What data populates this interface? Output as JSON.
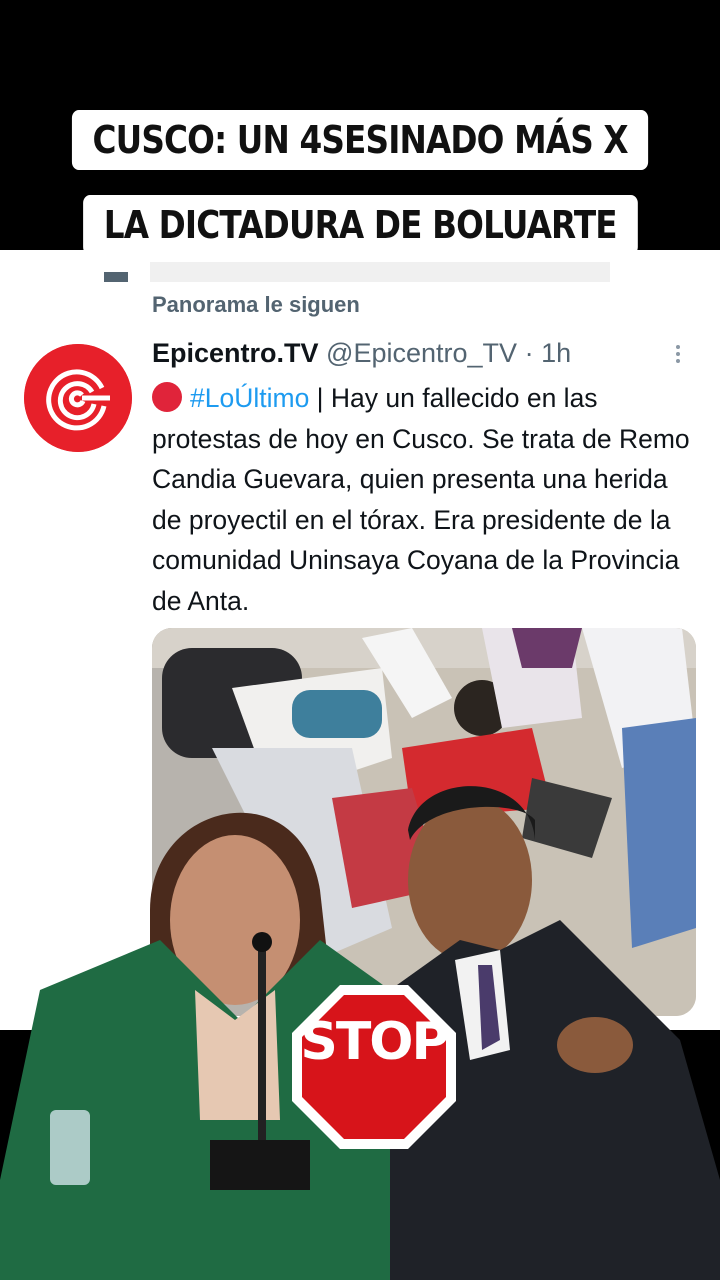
{
  "caption": {
    "line1": "CUSCO: UN 4SESINADO MÁS X",
    "line2": "LA DICTADURA DE BOLUARTE"
  },
  "context": {
    "text": "Panorama le siguen"
  },
  "tweet": {
    "author": "Epicentro.TV",
    "handle": "@Epicentro_TV",
    "separator": "·",
    "time": "1h",
    "hashtag": "#LoÚltimo",
    "body": " | Hay un fallecido en las protestas de hoy en Cusco. Se trata de Remo Candia Guevara, quien presenta una herida de proyectil en el tórax. Era presidente de la comunidad Uninsaya Coyana de la Provincia de Anta."
  },
  "stop_sign": {
    "text": "STOP"
  },
  "colors": {
    "brand_red": "#e7202a",
    "link_blue": "#1d9bf0",
    "muted_gray": "#536471",
    "text_dark": "#0f1419",
    "stop_red": "#d7141a"
  }
}
